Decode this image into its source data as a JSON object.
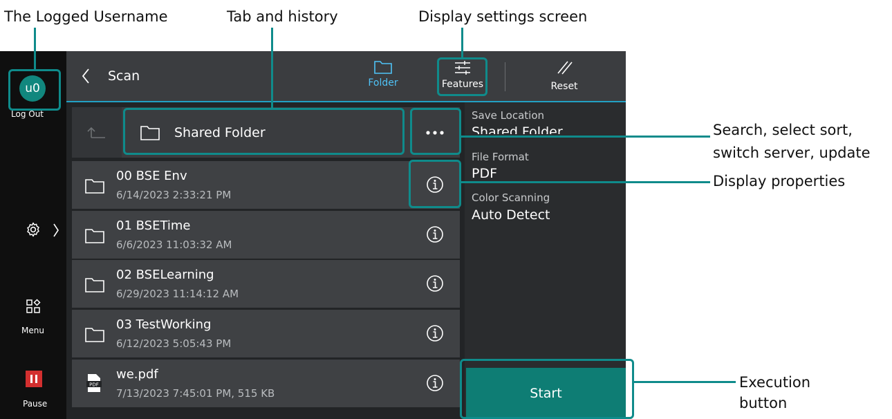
{
  "annotations": {
    "logged_username": "The Logged Username",
    "tab_history": "Tab and history",
    "display_settings": "Display settings screen",
    "search_line1": "Search, select sort,",
    "search_line2": "switch server, update",
    "display_properties": "Display properties",
    "execution_line1": "Execution",
    "execution_line2": "button"
  },
  "sidebar": {
    "user_initials": "u0",
    "logout_label": "Log Out",
    "menu_label": "Menu",
    "pause_label": "Pause"
  },
  "header": {
    "back_label": "Scan",
    "folder_label": "Folder",
    "features_label": "Features",
    "reset_label": "Reset"
  },
  "folder_bar": {
    "current_folder": "Shared Folder"
  },
  "file_list": [
    {
      "name": "00 BSE Env",
      "date": "6/14/2023 2:33:21 PM",
      "type": "folder"
    },
    {
      "name": "01 BSETime",
      "date": "6/6/2023 11:03:32 AM",
      "type": "folder"
    },
    {
      "name": "02 BSELearning",
      "date": "6/29/2023 11:14:12 AM",
      "type": "folder"
    },
    {
      "name": "03 TestWorking",
      "date": "6/12/2023 5:05:43 PM",
      "type": "folder"
    },
    {
      "name": "we.pdf",
      "date": "7/13/2023 7:45:01 PM, 515 KB",
      "type": "pdf"
    }
  ],
  "settings_panel": {
    "save_location_label": "Save Location",
    "save_location_value": "Shared Folder",
    "file_format_label": "File Format",
    "file_format_value": "PDF",
    "color_scanning_label": "Color Scanning",
    "color_scanning_value": "Auto Detect"
  },
  "start_label": "Start",
  "icons": {
    "folder": "folder-icon",
    "info": "info-icon",
    "pdf": "pdf-file-icon",
    "settings": "gear-icon",
    "menu": "apps-grid-icon",
    "pause": "pause-icon",
    "features": "sliders-icon",
    "reset": "reset-icon",
    "back": "chevron-left-icon",
    "up": "folder-up-icon",
    "more": "more-dots-icon"
  },
  "colors": {
    "accent_teal": "#0f8b8b",
    "start_button": "#0e7d74",
    "active_tab": "#4fc3f7",
    "pause_red": "#d32f2f",
    "avatar": "#11877e"
  }
}
